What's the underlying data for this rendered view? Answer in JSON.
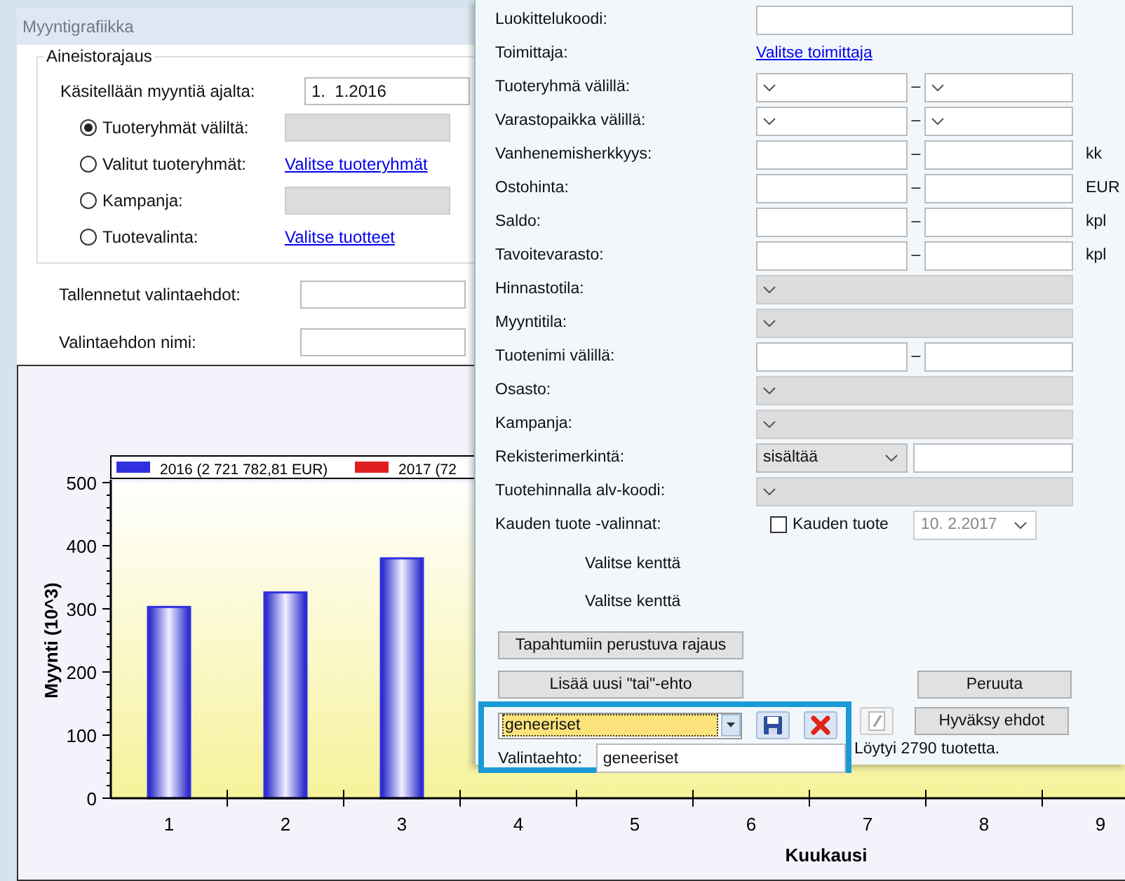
{
  "window": {
    "title": "Myyntigrafiikka"
  },
  "data_scope": {
    "title": "Aineistorajaus",
    "period_label": "Käsitellään myyntiä ajalta:",
    "period_value": "1.  1.2016",
    "options": [
      {
        "label": "Tuoteryhmät väliltä:",
        "selected": true,
        "kind": "field",
        "disabled": true
      },
      {
        "label": "Valitut tuoteryhmät:",
        "selected": false,
        "kind": "link",
        "link": "Valitse tuoteryhmät"
      },
      {
        "label": "Kampanja:",
        "selected": false,
        "kind": "field",
        "disabled": true
      },
      {
        "label": "Tuotevalinta:",
        "selected": false,
        "kind": "link",
        "link": "Valitse tuotteet"
      }
    ]
  },
  "saved_criteria": {
    "label": "Tallennetut valintaehdot:"
  },
  "criteria_name": {
    "label": "Valintaehdon nimi:"
  },
  "chart": {
    "chart_data": {
      "type": "bar",
      "xlabel": "Kuukausi",
      "ylabel": "Myynti (10^3)",
      "categories": [
        "1",
        "2",
        "3",
        "4",
        "5",
        "6",
        "7",
        "8",
        "9"
      ],
      "series": [
        {
          "name": "2016 (2 721 782,81  EUR)",
          "color": "#3030e0",
          "values": [
            303,
            326,
            380,
            null,
            null,
            null,
            null,
            null,
            null
          ]
        },
        {
          "name": "2017 (72",
          "color": "#e02020",
          "values": [
            null,
            null,
            null,
            null,
            null,
            null,
            null,
            null,
            null
          ]
        }
      ],
      "ylim": [
        0,
        500
      ],
      "yticks": [
        0,
        100,
        200,
        300,
        400,
        500
      ]
    }
  },
  "filter_panel": {
    "rows": [
      {
        "kind": "text",
        "label": "Luokittelukoodi:"
      },
      {
        "kind": "link",
        "label": "Toimittaja:",
        "link": "Valitse toimittaja"
      },
      {
        "kind": "combo-range",
        "label": "Tuoteryhmä välillä:",
        "separator": "–"
      },
      {
        "kind": "combo-range",
        "label": "Varastopaikka välillä:",
        "separator": "–"
      },
      {
        "kind": "text-range",
        "label": "Vanhenemisherkkyys:",
        "separator": "–",
        "unit": "kk"
      },
      {
        "kind": "text-range",
        "label": "Ostohinta:",
        "separator": "–",
        "unit": "EUR"
      },
      {
        "kind": "text-range",
        "label": "Saldo:",
        "separator": "–",
        "unit": "kpl"
      },
      {
        "kind": "text-range",
        "label": "Tavoitevarasto:",
        "separator": "–",
        "unit": "kpl"
      },
      {
        "kind": "combo",
        "label": "Hinnastotila:",
        "disabled": true
      },
      {
        "kind": "combo",
        "label": "Myyntitila:",
        "disabled": true
      },
      {
        "kind": "text-range",
        "label": "Tuotenimi välillä:",
        "separator": "–"
      },
      {
        "kind": "combo",
        "label": "Osasto:",
        "disabled": true
      },
      {
        "kind": "combo",
        "label": "Kampanja:",
        "disabled": true
      },
      {
        "kind": "operator",
        "label": "Rekisterimerkintä:",
        "operator": "sisältää"
      },
      {
        "kind": "combo",
        "label": "Tuotehinnalla alv-koodi:",
        "disabled": true
      },
      {
        "kind": "season",
        "label": "Kauden tuote -valinnat:",
        "checkbox": "Kauden tuote",
        "checked": false,
        "date": "10. 2.2017",
        "date_disabled": true
      }
    ],
    "field_pickers": [
      "Valitse kenttä",
      "Valitse kenttä"
    ],
    "buttons": {
      "events": "Tapahtumiin perustuva rajaus",
      "add_or": "Lisää uusi \"tai\"-ehto",
      "cancel": "Peruuta",
      "accept": "Hyväksy ehdot"
    },
    "preset": {
      "value": "geneeriset",
      "name_label": "Valintaehto:",
      "name_value": "geneeriset"
    },
    "status": "Löytyi 2790 tuotetta."
  }
}
